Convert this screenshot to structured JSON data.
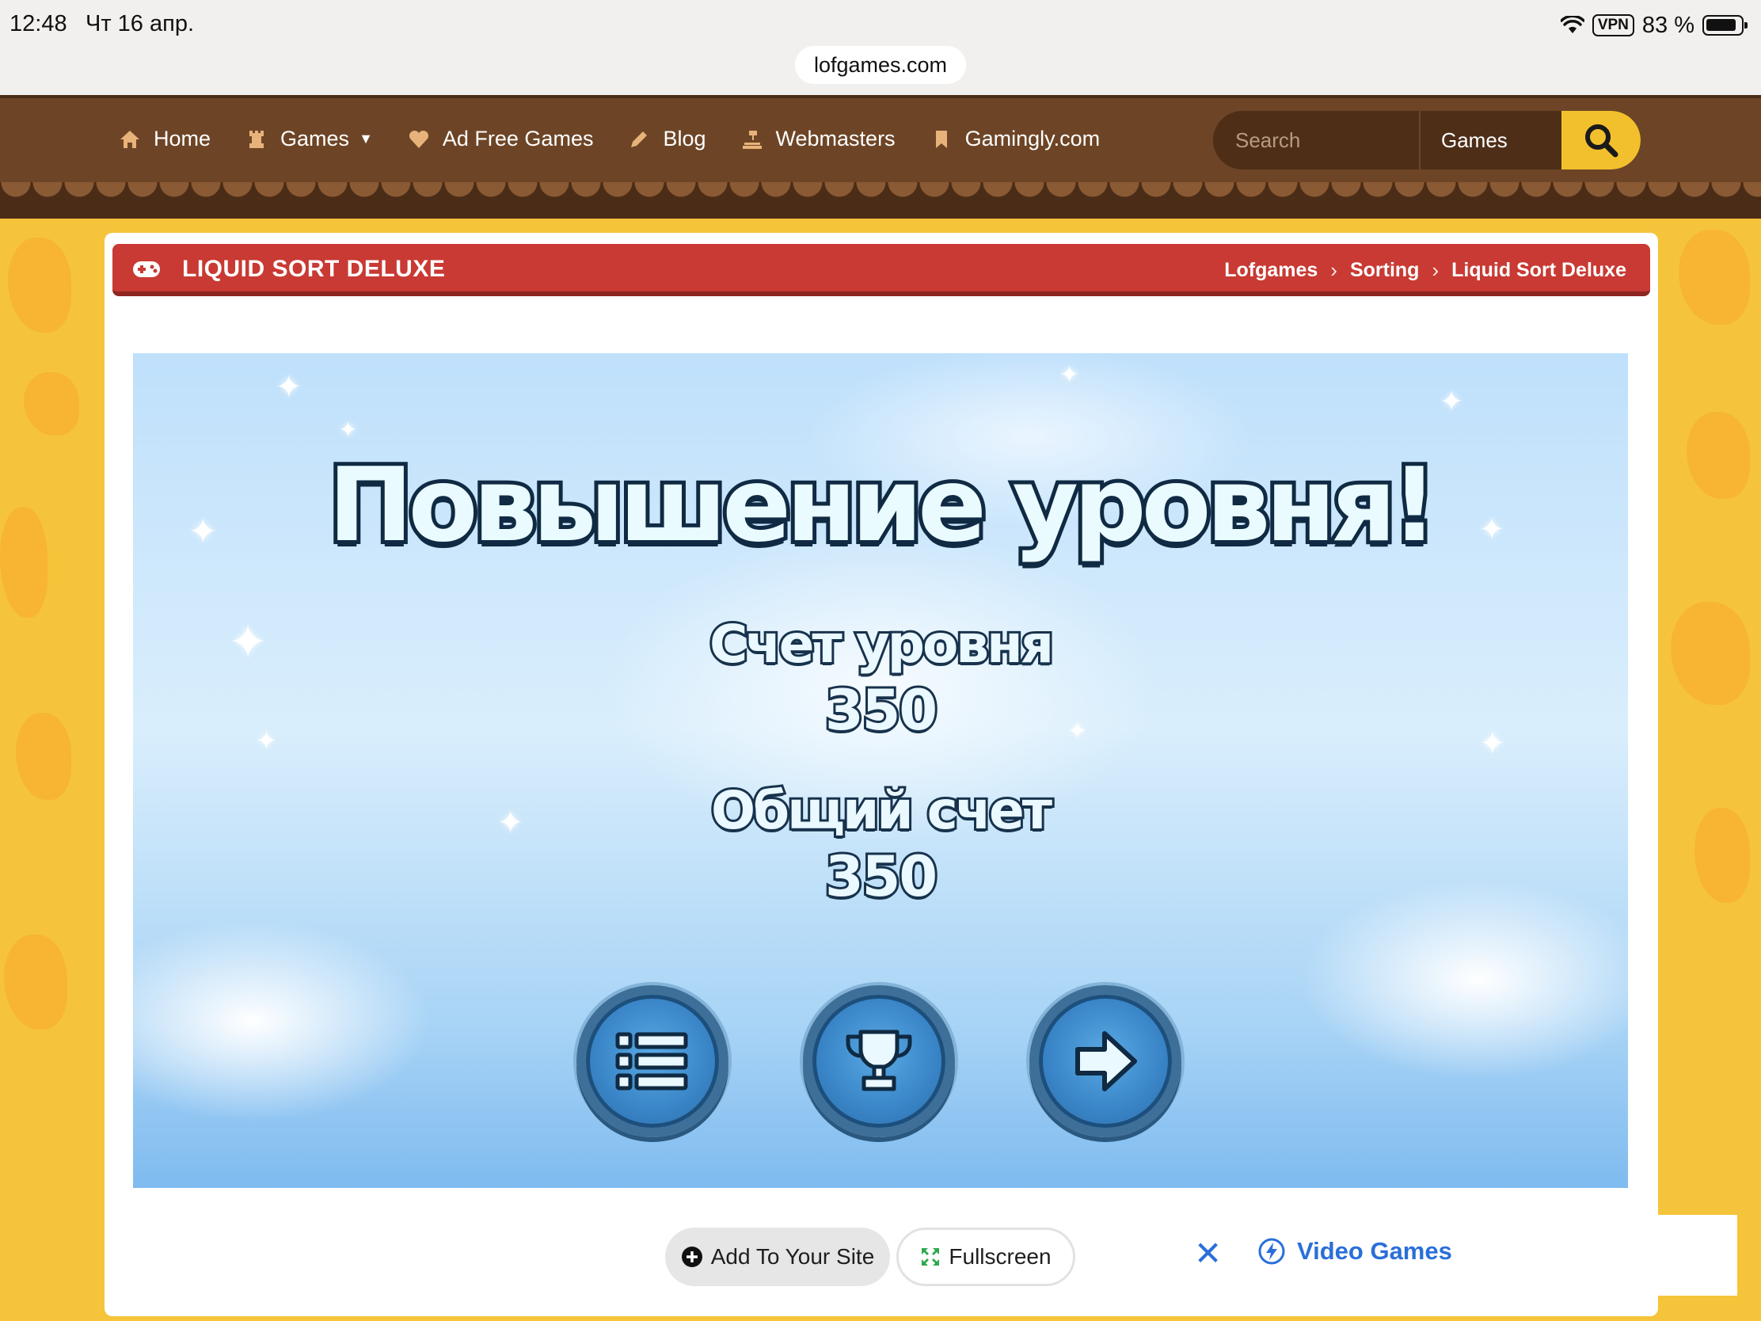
{
  "status_bar": {
    "time": "12:48",
    "date": "Чт 16 апр.",
    "vpn": "VPN",
    "battery": "83 %",
    "url": "lofgames.com"
  },
  "nav": {
    "items": [
      {
        "label": "Home",
        "icon": "home-icon"
      },
      {
        "label": "Games",
        "icon": "chess-rook-icon"
      },
      {
        "label": "Ad Free Games",
        "icon": "heart-icon"
      },
      {
        "label": "Blog",
        "icon": "pencil-icon"
      },
      {
        "label": "Webmasters",
        "icon": "gavel-icon"
      },
      {
        "label": "Gamingly.com",
        "icon": "bookmark-icon"
      }
    ],
    "search_placeholder": "Search",
    "search_category": "Games"
  },
  "game": {
    "title": "LIQUID SORT DELUXE",
    "breadcrumb": [
      "Lofgames",
      "Sorting",
      "Liquid Sort Deluxe"
    ],
    "heading": "Повышение уровня!",
    "level_score_label": "Счет уровня",
    "level_score_value": "350",
    "total_score_label": "Общий счет",
    "total_score_value": "350",
    "buttons": [
      "menu-list-icon",
      "trophy-icon",
      "next-arrow-icon"
    ]
  },
  "actions": {
    "add_to_site": "Add To Your Site",
    "fullscreen": "Fullscreen"
  },
  "ad": {
    "link": "Video Games"
  },
  "colors": {
    "header_brown": "#6d4526",
    "title_red": "#c83a33",
    "search_yellow": "#f3c02d",
    "link_blue": "#2a6fd8"
  }
}
